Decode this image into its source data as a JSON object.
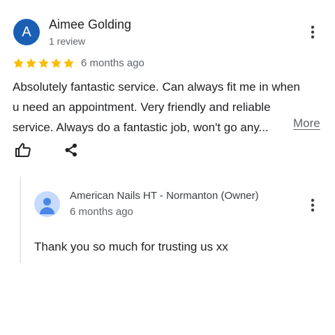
{
  "review": {
    "avatar_letter": "A",
    "avatar_color": "#1a5fb4",
    "author": "Aimee Golding",
    "review_count": "1 review",
    "rating": 5,
    "star_color": "#fbbc04",
    "time": "6 months ago",
    "text_lines": [
      "Absolutely fantastic service. Can always fit me in when",
      "u need an appointment. Very friendly and reliable",
      "service. Always do a fantastic job, won't go any..."
    ],
    "more_label": "More",
    "icons": {
      "menu": "more-vert-icon",
      "like": "thumbs-up-icon",
      "share": "share-icon"
    }
  },
  "owner_reply": {
    "avatar_color": "#c6dafc",
    "name": "American Nails HT - Normanton (Owner)",
    "time": "6 months ago",
    "text": "Thank you so much for trusting us xx",
    "icons": {
      "avatar": "person-icon",
      "menu": "more-vert-icon"
    }
  }
}
